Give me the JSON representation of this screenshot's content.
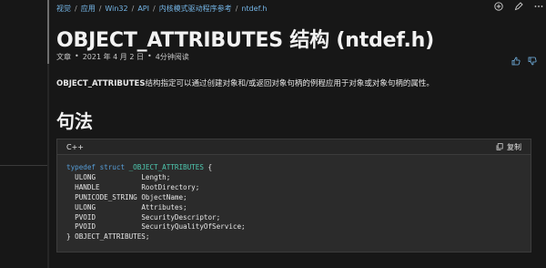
{
  "breadcrumb": [
    "视觉",
    "应用",
    "Win32",
    "API",
    "内核模式驱动程序参考",
    "ntdef.h"
  ],
  "page": {
    "title": "OBJECT_ATTRIBUTES 结构 (ntdef.h)",
    "meta_type": "文章",
    "meta_date": "2021 年 4 月 2 日",
    "meta_read": "4分钟阅读"
  },
  "summary": {
    "term": "OBJECT_ATTRIBUTES",
    "text": "结构指定可以通过创建对象和/或返回对象句柄的例程应用于对象或对象句柄的属性。"
  },
  "syntax": {
    "heading": "句法",
    "lang": "C++",
    "copy_label": "复制",
    "code": {
      "kw_typedef": "typedef",
      "kw_struct": "struct",
      "struct_name": "_OBJECT_ATTRIBUTES",
      "open": " {",
      "fields": [
        {
          "type": "ULONG",
          "name": "Length;"
        },
        {
          "type": "HANDLE",
          "name": "RootDirectory;"
        },
        {
          "type": "PUNICODE_STRING",
          "name": "ObjectName;"
        },
        {
          "type": "ULONG",
          "name": "Attributes;"
        },
        {
          "type": "PVOID",
          "name": "SecurityDescriptor;"
        },
        {
          "type": "PVOID",
          "name": "SecurityQualityOfService;"
        }
      ],
      "close": "} OBJECT_ATTRIBUTES;"
    }
  },
  "icons": {
    "top_actions": [
      "add-icon",
      "edit-icon",
      "more-icon"
    ],
    "feedback": [
      "thumbs-up-icon",
      "thumbs-down-icon"
    ],
    "copy": "copy-icon"
  },
  "colors": {
    "link": "#75b6e7",
    "background": "#171717",
    "code_background": "#2b2b2b",
    "keyword": "#569cd6",
    "type_name": "#4ec9b0"
  }
}
